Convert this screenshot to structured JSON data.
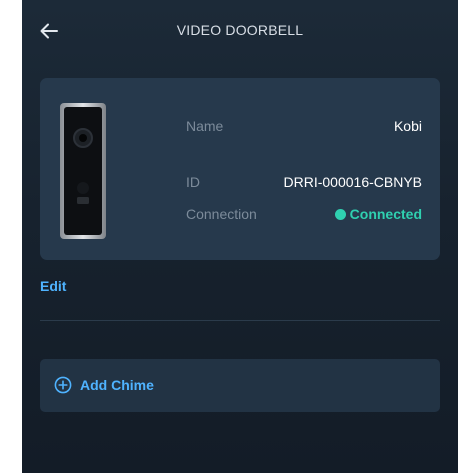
{
  "header": {
    "title": "VIDEO DOORBELL",
    "back_icon": "arrow-left-icon"
  },
  "device": {
    "name_label": "Name",
    "name_value": "Kobi",
    "id_label": "ID",
    "id_value": "DRRI-000016-CBNYB",
    "connection_label": "Connection",
    "connection_value": "Connected",
    "status_color": "#2fd0b0"
  },
  "actions": {
    "edit_label": "Edit",
    "add_chime_label": "Add Chime",
    "add_chime_icon": "plus-circle-icon"
  },
  "colors": {
    "background": "#17222e",
    "card": "#26394c",
    "accent": "#4fb3ff"
  }
}
